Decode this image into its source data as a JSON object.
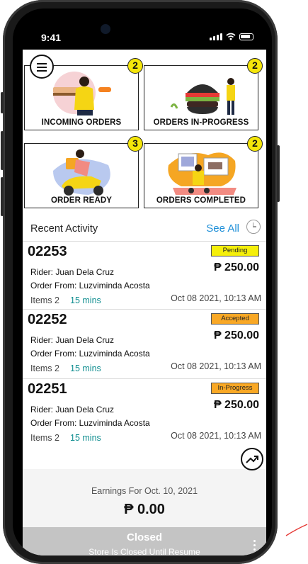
{
  "status_bar": {
    "time": "9:41"
  },
  "tiles": [
    {
      "label": "INCOMING ORDERS",
      "count": "2",
      "illustration": "rider-with-box-icon"
    },
    {
      "label": "ORDERS IN-PROGRESS",
      "count": "2",
      "illustration": "burger-icon"
    },
    {
      "label": "ORDER READY",
      "count": "3",
      "illustration": "scooter-delivery-icon"
    },
    {
      "label": "ORDERS COMPLETED",
      "count": "2",
      "illustration": "delivered-package-icon"
    }
  ],
  "recent": {
    "title": "Recent Activity",
    "see_all": "See All"
  },
  "orders": [
    {
      "id": "02253",
      "status": "Pending",
      "status_color": "#f5ef0a",
      "amount": "₱ 250.00",
      "rider": "Rider: Juan Dela Cruz",
      "from": "Order From: Luzviminda Acosta",
      "items": "Items 2",
      "mins": "15 mins",
      "date": "Oct 08 2021, 10:13 AM"
    },
    {
      "id": "02252",
      "status": "Accepted",
      "status_color": "#f9a825",
      "amount": "₱ 250.00",
      "rider": "Rider: Juan Dela Cruz",
      "from": "Order From: Luzviminda Acosta",
      "items": "Items 2",
      "mins": "15 mins",
      "date": "Oct 08 2021, 10:13 AM"
    },
    {
      "id": "02251",
      "status": "In-Progress",
      "status_color": "#f9a825",
      "amount": "₱ 250.00",
      "rider": "Rider: Juan Dela Cruz",
      "from": "Order From: Luzviminda Acosta",
      "items": "Items 2",
      "mins": "15 mins",
      "date": "Oct 08 2021, 10:13 AM"
    }
  ],
  "earnings": {
    "label": "Earnings For Oct. 10, 2021",
    "value": "₱ 0.00"
  },
  "store": {
    "title": "Closed",
    "subtitle": "Store Is Closed Until Resume"
  },
  "colors": {
    "badge": "#f5e60a",
    "see_all": "#1e8fd8",
    "mins": "#0e8d8f",
    "closed_bar": "#c4c4c4"
  }
}
